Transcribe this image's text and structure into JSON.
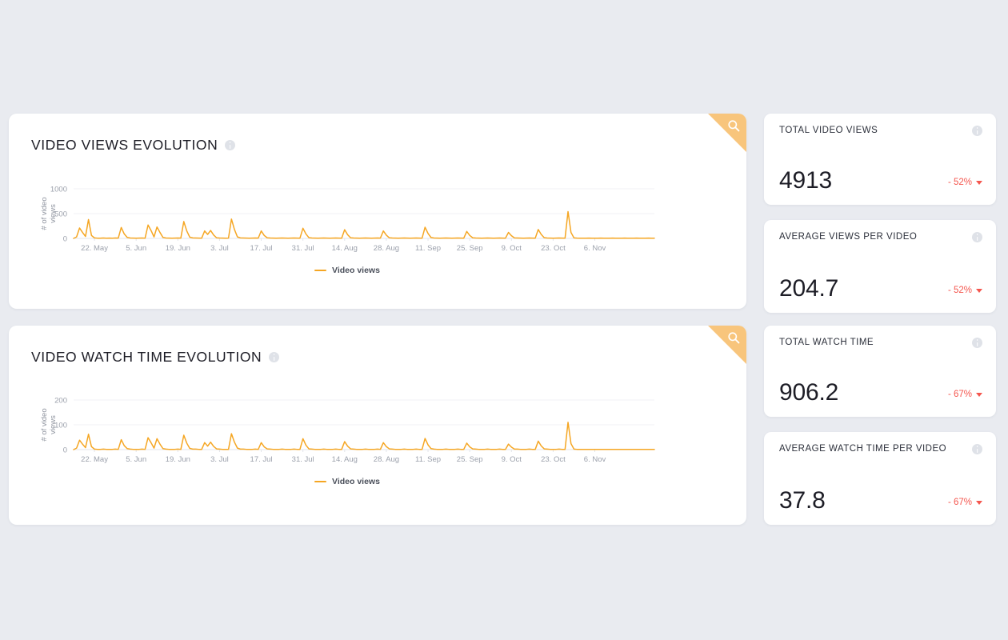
{
  "theme": {
    "page_background": "#e9ebf0",
    "card_background": "#ffffff",
    "series_color": "#f5a623",
    "corner_accent": "#f8c57c",
    "negative_color": "#f4564e",
    "title_color": "#1d1d26"
  },
  "charts": [
    {
      "title": "VIDEO VIEWS EVOLUTION",
      "info_icon": "info-icon",
      "corner_icon": "search-icon",
      "legend_label": "Video views"
    },
    {
      "title": "VIDEO WATCH TIME EVOLUTION",
      "info_icon": "info-icon",
      "corner_icon": "search-icon",
      "legend_label": "Video views"
    }
  ],
  "kpis": [
    {
      "label": "TOTAL VIDEO VIEWS",
      "value": "4913",
      "delta": "- 52%",
      "delta_direction": "down",
      "info_icon": "info-icon"
    },
    {
      "label": "AVERAGE VIEWS PER VIDEO",
      "value": "204.7",
      "delta": "- 52%",
      "delta_direction": "down",
      "info_icon": "info-icon"
    },
    {
      "label": "TOTAL WATCH TIME",
      "value": "906.2",
      "delta": "- 67%",
      "delta_direction": "down",
      "info_icon": "info-icon"
    },
    {
      "label": "AVERAGE WATCH TIME PER VIDEO",
      "value": "37.8",
      "delta": "- 67%",
      "delta_direction": "down",
      "info_icon": "info-icon"
    }
  ],
  "chart_data": [
    {
      "type": "line",
      "title": "VIDEO VIEWS EVOLUTION",
      "xlabel": "",
      "ylabel": "# of video views",
      "ylim": [
        0,
        1000
      ],
      "yticks": [
        0,
        500,
        1000
      ],
      "grid": true,
      "legend": "bottom",
      "xtick_labels": [
        "22. May",
        "5. Jun",
        "19. Jun",
        "3. Jul",
        "17. Jul",
        "31. Jul",
        "14. Aug",
        "28. Aug",
        "11. Sep",
        "25. Sep",
        "9. Oct",
        "23. Oct",
        "6. Nov"
      ],
      "xtick_indices": [
        7,
        21,
        35,
        49,
        63,
        77,
        91,
        105,
        119,
        133,
        147,
        161,
        175
      ],
      "series": [
        {
          "name": "Video views",
          "color": "#f5a623",
          "values": [
            0,
            30,
            210,
            120,
            40,
            380,
            60,
            10,
            5,
            5,
            8,
            5,
            6,
            5,
            8,
            6,
            220,
            90,
            20,
            8,
            6,
            5,
            6,
            8,
            5,
            270,
            160,
            30,
            230,
            120,
            20,
            8,
            6,
            5,
            6,
            8,
            6,
            340,
            150,
            25,
            10,
            8,
            6,
            5,
            150,
            80,
            160,
            70,
            12,
            8,
            6,
            5,
            6,
            390,
            180,
            30,
            10,
            8,
            6,
            5,
            6,
            8,
            6,
            150,
            60,
            12,
            8,
            6,
            5,
            6,
            8,
            6,
            5,
            6,
            8,
            6,
            5,
            205,
            90,
            15,
            8,
            6,
            5,
            6,
            8,
            6,
            5,
            6,
            8,
            6,
            5,
            175,
            75,
            12,
            8,
            6,
            5,
            6,
            8,
            6,
            5,
            6,
            8,
            6,
            150,
            65,
            12,
            8,
            6,
            5,
            6,
            8,
            6,
            5,
            6,
            8,
            6,
            5,
            225,
            100,
            18,
            8,
            6,
            5,
            6,
            8,
            6,
            5,
            6,
            8,
            6,
            5,
            140,
            60,
            12,
            8,
            6,
            5,
            6,
            8,
            6,
            5,
            6,
            8,
            6,
            5,
            120,
            55,
            10,
            8,
            6,
            5,
            6,
            8,
            6,
            5,
            180,
            80,
            14,
            8,
            6,
            5,
            6,
            8,
            6,
            5,
            540,
            120,
            10,
            6,
            5,
            4,
            5,
            6,
            5,
            4,
            5,
            6,
            5,
            4,
            5,
            6,
            5,
            4,
            5,
            6,
            5,
            4,
            5,
            6,
            5,
            4,
            5,
            6,
            5,
            4
          ]
        }
      ]
    },
    {
      "type": "line",
      "title": "VIDEO WATCH TIME EVOLUTION",
      "xlabel": "",
      "ylabel": "# of video views",
      "ylim": [
        0,
        200
      ],
      "yticks": [
        0,
        100,
        200
      ],
      "grid": true,
      "legend": "bottom",
      "xtick_labels": [
        "22. May",
        "5. Jun",
        "19. Jun",
        "3. Jul",
        "17. Jul",
        "31. Jul",
        "14. Aug",
        "28. Aug",
        "11. Sep",
        "25. Sep",
        "9. Oct",
        "23. Oct",
        "6. Nov"
      ],
      "xtick_indices": [
        7,
        21,
        35,
        49,
        63,
        77,
        91,
        105,
        119,
        133,
        147,
        161,
        175
      ],
      "series": [
        {
          "name": "Video views",
          "color": "#f5a623",
          "values": [
            0,
            6,
            38,
            22,
            8,
            62,
            12,
            2,
            1,
            1,
            2,
            1,
            1,
            1,
            2,
            1,
            40,
            16,
            4,
            2,
            1,
            1,
            1,
            2,
            1,
            48,
            28,
            6,
            44,
            22,
            4,
            2,
            1,
            1,
            1,
            2,
            1,
            58,
            26,
            5,
            2,
            2,
            1,
            1,
            28,
            14,
            30,
            13,
            3,
            2,
            1,
            1,
            1,
            64,
            30,
            6,
            2,
            2,
            1,
            1,
            1,
            2,
            1,
            28,
            11,
            3,
            2,
            1,
            1,
            1,
            2,
            1,
            1,
            1,
            2,
            1,
            1,
            44,
            18,
            3,
            2,
            1,
            1,
            1,
            2,
            1,
            1,
            1,
            2,
            1,
            1,
            32,
            14,
            3,
            2,
            1,
            1,
            1,
            2,
            1,
            1,
            1,
            2,
            1,
            28,
            12,
            3,
            2,
            1,
            1,
            1,
            2,
            1,
            1,
            1,
            2,
            1,
            1,
            45,
            19,
            4,
            2,
            1,
            1,
            1,
            2,
            1,
            1,
            1,
            2,
            1,
            1,
            26,
            11,
            3,
            2,
            1,
            1,
            1,
            2,
            1,
            1,
            1,
            2,
            1,
            1,
            22,
            10,
            2,
            2,
            1,
            1,
            1,
            2,
            1,
            1,
            34,
            15,
            3,
            2,
            1,
            1,
            1,
            2,
            1,
            1,
            110,
            24,
            2,
            1,
            1,
            1,
            1,
            1,
            1,
            1,
            1,
            1,
            1,
            1,
            1,
            1,
            1,
            1,
            1,
            1,
            1,
            1,
            1,
            1,
            1,
            1,
            1,
            1,
            1,
            1
          ]
        }
      ]
    }
  ]
}
